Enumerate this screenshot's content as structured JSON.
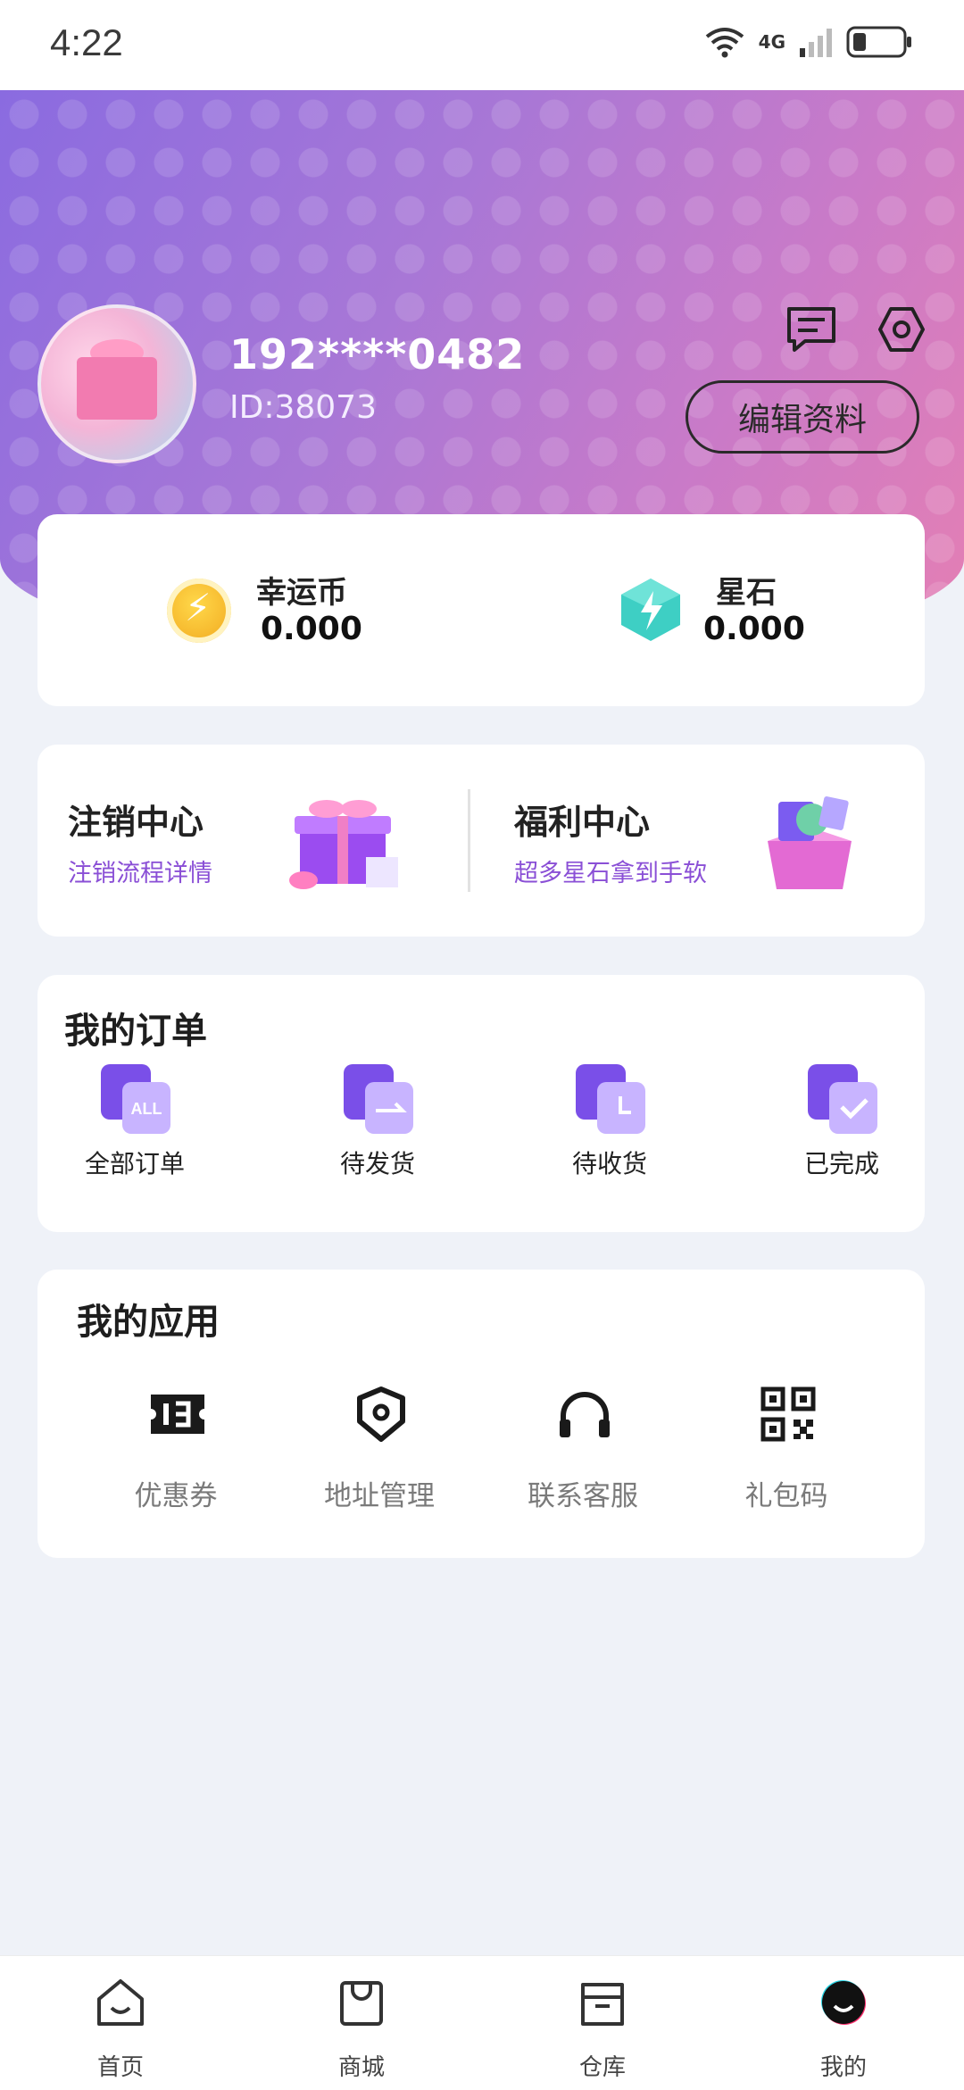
{
  "status": {
    "time": "4:22",
    "network": "4G"
  },
  "profile": {
    "phone": "192****0482",
    "id_text": "ID:38073",
    "edit_label": "编辑资料"
  },
  "wallet": {
    "lucky_coin_label": "幸运币",
    "lucky_coin_value": "0.000",
    "star_stone_label": "星石",
    "star_stone_value": "0.000"
  },
  "promos": [
    {
      "title": "注销中心",
      "subtitle": "注销流程详情"
    },
    {
      "title": "福利中心",
      "subtitle": "超多星石拿到手软"
    }
  ],
  "orders": {
    "title": "我的订单",
    "items": [
      {
        "label": "全部订单",
        "badge": "ALL"
      },
      {
        "label": "待发货"
      },
      {
        "label": "待收货"
      },
      {
        "label": "已完成"
      }
    ]
  },
  "apps": {
    "title": "我的应用",
    "items": [
      {
        "label": "优惠券",
        "icon": "coupon-icon"
      },
      {
        "label": "地址管理",
        "icon": "location-icon"
      },
      {
        "label": "联系客服",
        "icon": "headset-icon"
      },
      {
        "label": "礼包码",
        "icon": "qr-code-icon"
      }
    ]
  },
  "tabs": [
    {
      "label": "首页",
      "icon": "home-icon"
    },
    {
      "label": "商城",
      "icon": "shopping-bag-icon"
    },
    {
      "label": "仓库",
      "icon": "warehouse-icon"
    },
    {
      "label": "我的",
      "icon": "profile-icon",
      "active": true
    }
  ],
  "colors": {
    "accent": "#8a4fd6",
    "background": "#eff2f8",
    "hero_start": "#8a6be0",
    "hero_end": "#e57fb3"
  }
}
